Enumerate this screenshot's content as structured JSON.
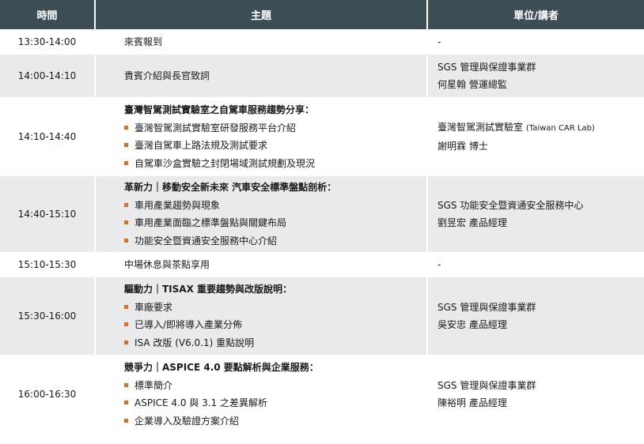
{
  "header": {
    "time": "時間",
    "topic": "主題",
    "unit": "單位/講者"
  },
  "rows": [
    {
      "time": "13:30-14:00",
      "topic": "來賓報到",
      "unit_lines": [
        "-"
      ]
    },
    {
      "time": "14:00-14:10",
      "topic": "貴賓介紹與長官致詞",
      "unit_lines": [
        "SGS 管理與保證事業群",
        "何星翰 營運總監"
      ]
    },
    {
      "time": "14:10-14:40",
      "title": "臺灣智駕測試實驗室之自駕車服務趨勢分享：",
      "items": [
        "臺灣智駕測試實驗室研發服務平台介紹",
        "臺灣自駕車上路法規及測試要求",
        "自駕車沙盒實驗之封閉場域測試規劃及現況"
      ],
      "unit_lines": [
        "臺灣智駕測試實驗室",
        "謝明霖 博士"
      ],
      "unit_suffix": "(Taiwan CAR Lab)"
    },
    {
      "time": "14:40-15:10",
      "title": "革新力｜移動安全新未來 汽車安全標準盤點剖析：",
      "items": [
        "車用產業趨勢與現象",
        "車用產業面臨之標準盤點與關鍵布局",
        "功能安全暨資通安全服務中心介紹"
      ],
      "unit_lines": [
        "SGS 功能安全暨資通安全服務中心",
        "劉昱宏 產品經理"
      ]
    },
    {
      "time": "15:10-15:30",
      "topic": "中場休息與茶點享用",
      "unit_lines": [
        "-"
      ]
    },
    {
      "time": "15:30-16:00",
      "title": "驅動力｜TISAX 重要趨勢與改版說明：",
      "items": [
        "車廠要求",
        "已導入/即將導入產業分佈",
        "ISA 改版 (V6.0.1) 重點說明"
      ],
      "unit_lines": [
        "SGS 管理與保證事業群",
        "吳安忠 產品經理"
      ]
    },
    {
      "time": "16:00-16:30",
      "title": "競爭力｜ASPICE 4.0 要點解析與企業服務：",
      "items": [
        "標準簡介",
        "ASPICE 4.0 與 3.1 之差異解析",
        "企業導入及驗證方案介紹"
      ],
      "unit_lines": [
        "SGS 管理與保證事業群",
        "陳裕明 產品經理"
      ]
    }
  ],
  "colors": {
    "header_bg": "#3d4d55",
    "row_alt_bg": "#e8eaeb",
    "bullet": "#e06c1e"
  },
  "icons": {
    "bullet": "orange-square-bullet"
  }
}
